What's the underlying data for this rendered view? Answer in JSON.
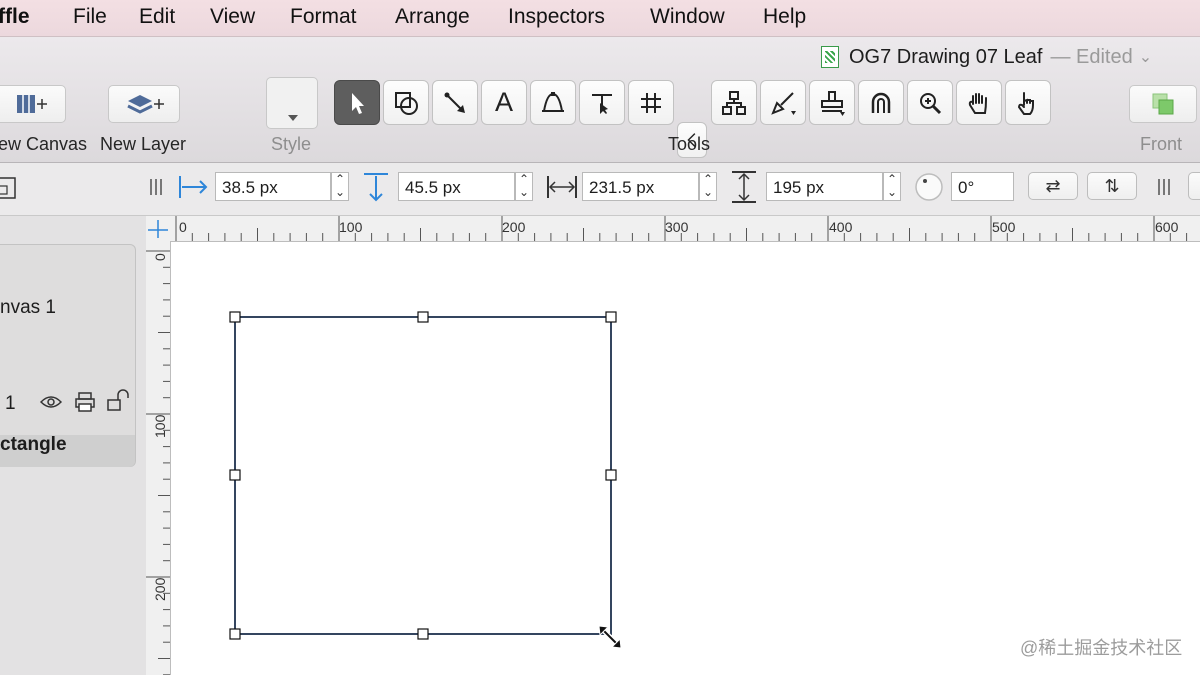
{
  "menu": [
    "ffle",
    "File",
    "Edit",
    "View",
    "Format",
    "Arrange",
    "Inspectors",
    "Window",
    "Help"
  ],
  "window": {
    "title": "OG7 Drawing 07 Leaf",
    "status": "— Edited"
  },
  "toolbar": {
    "new_canvas": "ew Canvas",
    "new_layer": "New Layer",
    "style": "Style",
    "tools": "Tools",
    "front": "Front"
  },
  "tools": [
    {
      "name": "selection-tool",
      "icon": "arrow-pointer"
    },
    {
      "name": "shape-tool",
      "icon": "shapes"
    },
    {
      "name": "line-tool",
      "icon": "line"
    },
    {
      "name": "text-tool",
      "icon": "text",
      "label": "A"
    },
    {
      "name": "bezier-tool",
      "icon": "bezier"
    },
    {
      "name": "point-editor-tool",
      "icon": "point-edit"
    },
    {
      "name": "diagram-tool",
      "icon": "hash"
    },
    {
      "name": "collapse-tools",
      "icon": "chevron-left"
    },
    {
      "name": "hierarchy-tool",
      "icon": "hierarchy"
    },
    {
      "name": "style-brush-tool",
      "icon": "brush"
    },
    {
      "name": "rubber-stamp-tool",
      "icon": "stamp"
    },
    {
      "name": "magnet-tool",
      "icon": "magnet"
    },
    {
      "name": "zoom-tool",
      "icon": "zoom-in"
    },
    {
      "name": "hand-tool",
      "icon": "hand"
    },
    {
      "name": "browse-tool",
      "icon": "pointing-hand"
    }
  ],
  "inspector": {
    "x": "38.5 px",
    "y": "45.5 px",
    "width": "231.5 px",
    "height": "195 px",
    "rotation": "0°"
  },
  "sidebar": {
    "canvas_name": "nvas 1",
    "layer_number": "1",
    "object_name": "ctangle"
  },
  "ruler": {
    "h": [
      "0",
      "100",
      "200",
      "300",
      "400",
      "500",
      "600"
    ],
    "v": [
      "0",
      "100",
      "200"
    ]
  },
  "watermark": "@稀土掘金技术社区",
  "colors": {
    "menubar": "#f3dfe3",
    "accent": "#2e86d9",
    "selection": "#34455f"
  }
}
